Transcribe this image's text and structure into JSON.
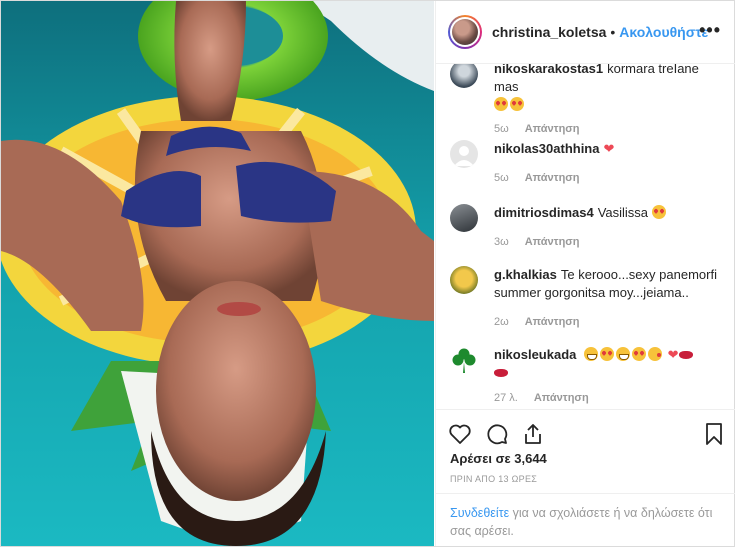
{
  "post": {
    "username": "christina_koletsa",
    "separator": "•",
    "follow_label": "Ακολουθήστε",
    "more_icon": "more-icon"
  },
  "comments": [
    {
      "user": "nikoskarakostas1",
      "text": "kormara treIane mas",
      "emoji": "heart-eyes x2",
      "time": "5ω",
      "reply": "Απάντηση"
    },
    {
      "user": "nikolas30athhina",
      "text": "",
      "emoji": "red-heart",
      "time": "5ω",
      "reply": "Απάντηση"
    },
    {
      "user": "dimitriosdimas4",
      "text": "Vasilissa",
      "emoji": "heart-eyes",
      "time": "3ω",
      "reply": "Απάντηση"
    },
    {
      "user": "g.khalkias",
      "text": "Te kerooo...sexy panemorfi summer gorgonitsa moy...jeiama..",
      "emoji": "",
      "time": "2ω",
      "reply": "Απάντηση"
    },
    {
      "user": "nikosleukada",
      "text": "",
      "emoji": "grin, heart-eyes, grin, heart-eyes, kiss, heart, lips, lips",
      "time": "27 λ.",
      "reply": "Απάντηση"
    }
  ],
  "likes": {
    "label": "Αρέσει σε 3,644"
  },
  "time_ago": "ΠΡΙΝ ΑΠΟ 13 ΩΡΕΣ",
  "login_prompt": {
    "link": "Συνδεθείτε",
    "text": " για να σχολιάσετε ή να δηλώσετε ότι σας αρέσει."
  },
  "colors": {
    "accent": "#3897f0",
    "heart": "#ed4956",
    "muted": "#999999",
    "text": "#262626"
  }
}
